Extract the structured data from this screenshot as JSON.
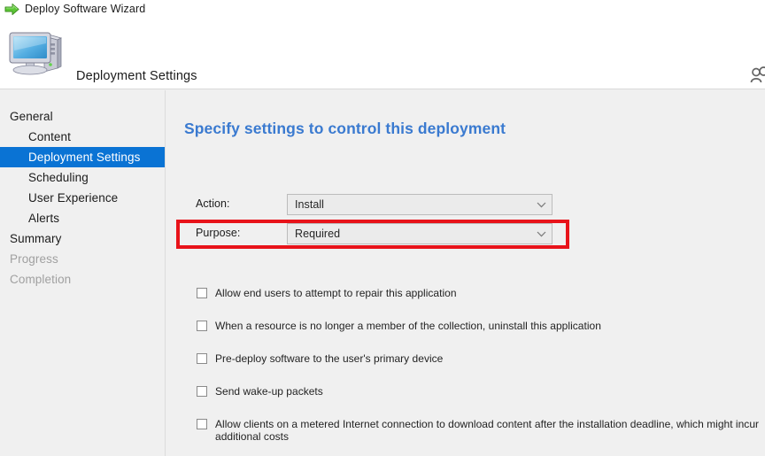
{
  "window": {
    "title": "Deploy Software Wizard",
    "title_icon": "green-arrow-icon"
  },
  "banner": {
    "title": "Deployment Settings",
    "icon": "computer-icon",
    "right_icon": "user-account-icon"
  },
  "sidebar": {
    "items": [
      {
        "label": "General",
        "level": 0,
        "state": "normal"
      },
      {
        "label": "Content",
        "level": 1,
        "state": "normal"
      },
      {
        "label": "Deployment Settings",
        "level": 1,
        "state": "selected"
      },
      {
        "label": "Scheduling",
        "level": 1,
        "state": "normal"
      },
      {
        "label": "User Experience",
        "level": 1,
        "state": "normal"
      },
      {
        "label": "Alerts",
        "level": 1,
        "state": "normal"
      },
      {
        "label": "Summary",
        "level": 0,
        "state": "normal"
      },
      {
        "label": "Progress",
        "level": 0,
        "state": "disabled"
      },
      {
        "label": "Completion",
        "level": 0,
        "state": "disabled"
      }
    ]
  },
  "main": {
    "heading": "Specify settings to control this deployment",
    "fields": {
      "action": {
        "label": "Action:",
        "value": "Install",
        "arrow_icon": "chevron-down-icon"
      },
      "purpose": {
        "label": "Purpose:",
        "value": "Required",
        "arrow_icon": "chevron-down-icon"
      }
    },
    "checkboxes": [
      {
        "label": "Allow end users to attempt to repair this application",
        "checked": false
      },
      {
        "label": "When a resource is no longer a member of the collection, uninstall this application",
        "checked": false
      },
      {
        "label": "Pre-deploy software to the user's primary device",
        "checked": false
      },
      {
        "label": "Send wake-up packets",
        "checked": false
      },
      {
        "label": "Allow clients on a metered Internet connection to download content after the installation deadline, which might incur additional costs",
        "checked": false
      }
    ]
  },
  "annotations": {
    "highlight_target": "purpose-row",
    "highlight_color": "#e8131a"
  },
  "colors": {
    "selection_blue": "#0a73d4",
    "heading_blue": "#3a7ad0",
    "window_background": "#f0f0f0",
    "banner_background": "#ffffff",
    "annotation_red": "#e8131a"
  }
}
